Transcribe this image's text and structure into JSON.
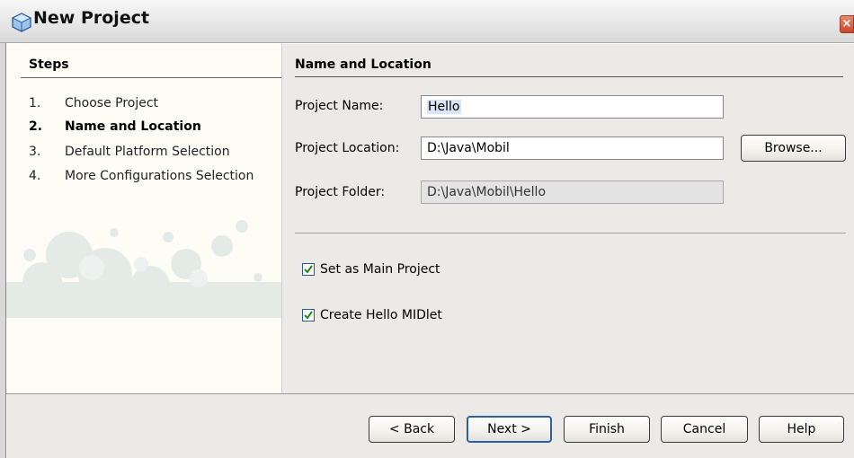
{
  "window": {
    "title": "New Project"
  },
  "steps": {
    "heading": "Steps",
    "items": [
      {
        "num": "1.",
        "label": "Choose Project"
      },
      {
        "num": "2.",
        "label": "Name and Location"
      },
      {
        "num": "3.",
        "label": "Default Platform Selection"
      },
      {
        "num": "4.",
        "label": "More Configurations Selection"
      }
    ],
    "current_index": 2
  },
  "panel": {
    "title": "Name and Location",
    "project_name": {
      "label": "Project Name:",
      "value": "Hello"
    },
    "project_location": {
      "label": "Project Location:",
      "value": "D:\\Java\\Mobil",
      "browse_label": "Browse..."
    },
    "project_folder": {
      "label": "Project Folder:",
      "value": "D:\\Java\\Mobil\\Hello"
    },
    "set_main": {
      "label": "Set as Main Project",
      "checked": true
    },
    "create_midlet": {
      "label": "Create Hello MIDlet",
      "checked": true
    }
  },
  "buttons": {
    "back": "< Back",
    "next": "Next >",
    "finish": "Finish",
    "cancel": "Cancel",
    "help": "Help"
  },
  "colors": {
    "steps_bg": "#fdfdf6",
    "content_bg": "#ebeae6",
    "default_button_border": "#2f5f9f"
  }
}
